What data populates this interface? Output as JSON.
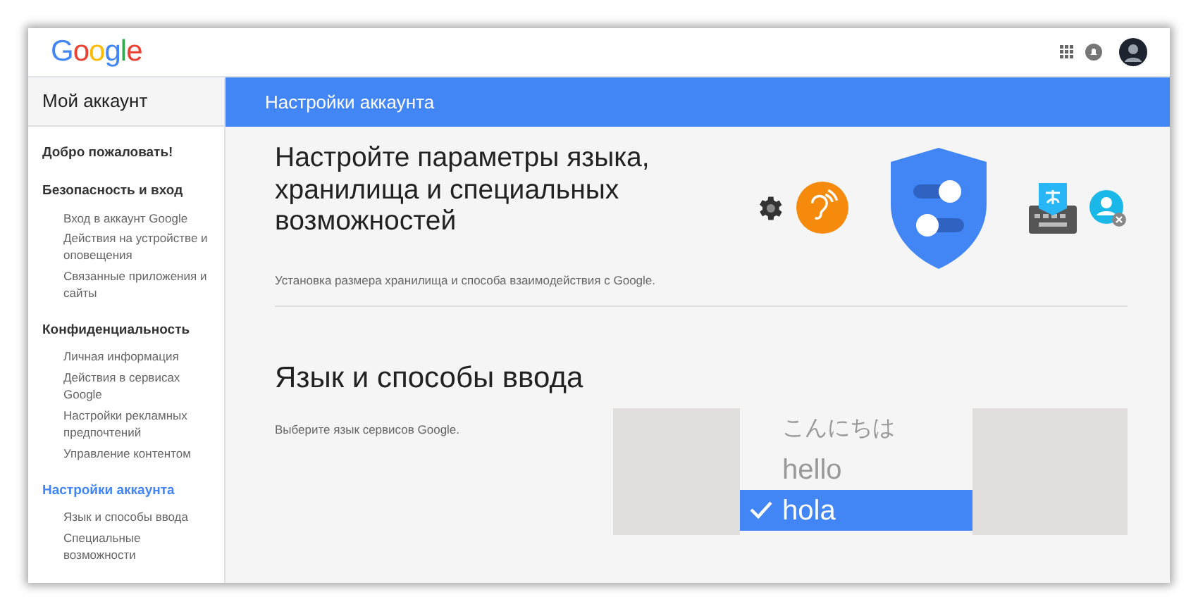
{
  "header": {
    "logo": "Google"
  },
  "sidebar": {
    "title": "Мой аккаунт",
    "sections": [
      {
        "label": "Добро пожаловать!",
        "selected": false
      },
      {
        "label": "Безопасность и вход",
        "selected": false,
        "items": [
          {
            "label": "Вход в аккаунт Google",
            "selected": false
          },
          {
            "label": "Действия на устройстве и оповещения",
            "selected": false
          },
          {
            "label": "Связанные приложения и сайты",
            "selected": false
          }
        ]
      },
      {
        "label": "Конфиденциальность",
        "selected": false,
        "items": [
          {
            "label": "Личная информация",
            "selected": false
          },
          {
            "label": "Действия в сервисах Google",
            "selected": false
          },
          {
            "label": "Настройки рекламных предпочтений",
            "selected": false
          },
          {
            "label": "Управление контентом",
            "selected": false
          }
        ]
      },
      {
        "label": "Настройки аккаунта",
        "selected": true,
        "items": [
          {
            "label": "Язык и способы ввода",
            "selected": false
          },
          {
            "label": "Специальные возможности",
            "selected": false
          }
        ]
      }
    ]
  },
  "banner": {
    "title": "Настройки аккаунта"
  },
  "intro": {
    "heading": "Настройте параметры языка, хранилища и специальных возможностей",
    "description": "Установка размера хранилища и способа взаимодействия с Google."
  },
  "language": {
    "heading": "Язык и способы ввода",
    "description": "Выберите язык сервисов Google.",
    "options": [
      {
        "label": "こんにちは",
        "selected": false
      },
      {
        "label": "hello",
        "selected": false
      },
      {
        "label": "hola",
        "selected": true
      }
    ]
  }
}
